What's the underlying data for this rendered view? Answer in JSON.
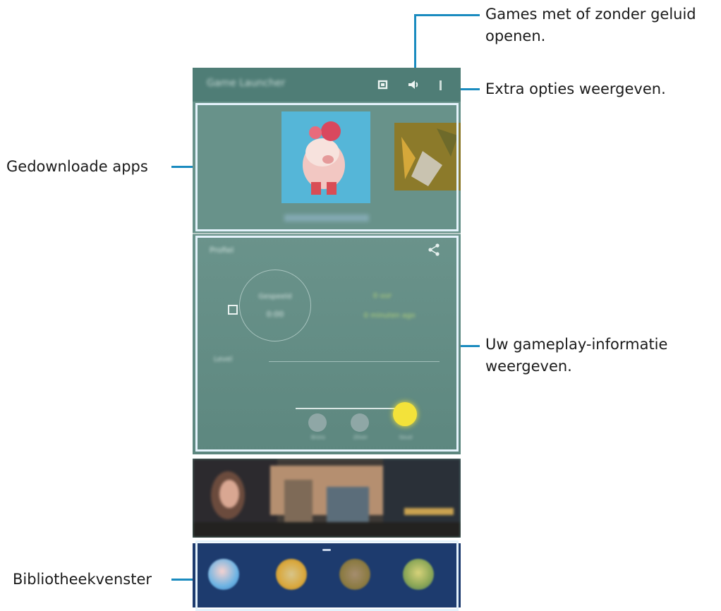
{
  "annotations": {
    "sound": "Games met of zonder geluid",
    "sound_line2": "openen.",
    "more_options": "Extra opties weergeven.",
    "downloaded_apps": "Gedownloade apps",
    "gameplay_info": "Uw gameplay-informatie",
    "gameplay_info_line2": "weergeven.",
    "library": "Bibliotheekvenster"
  },
  "phone": {
    "app_title": "Game Launcher",
    "icons": {
      "mute": "toggle-square-icon",
      "sound": "speaker-icon",
      "more": "more-vert-icon",
      "share": "share-icon"
    },
    "stats_title": "Profiel",
    "stats_circle_top": "Gespeeld",
    "stats_circle_value": "0:00",
    "stats_right_top": "0 uur",
    "stats_right_bottom": "0 minuten ago",
    "level_label": "Level",
    "level_badges": [
      "Brons",
      "Zilver",
      "Goud"
    ]
  },
  "colors": {
    "accent": "#1a8bbf",
    "phone_bg": "#5f8a82",
    "library_bg": "#1d3b6e"
  }
}
